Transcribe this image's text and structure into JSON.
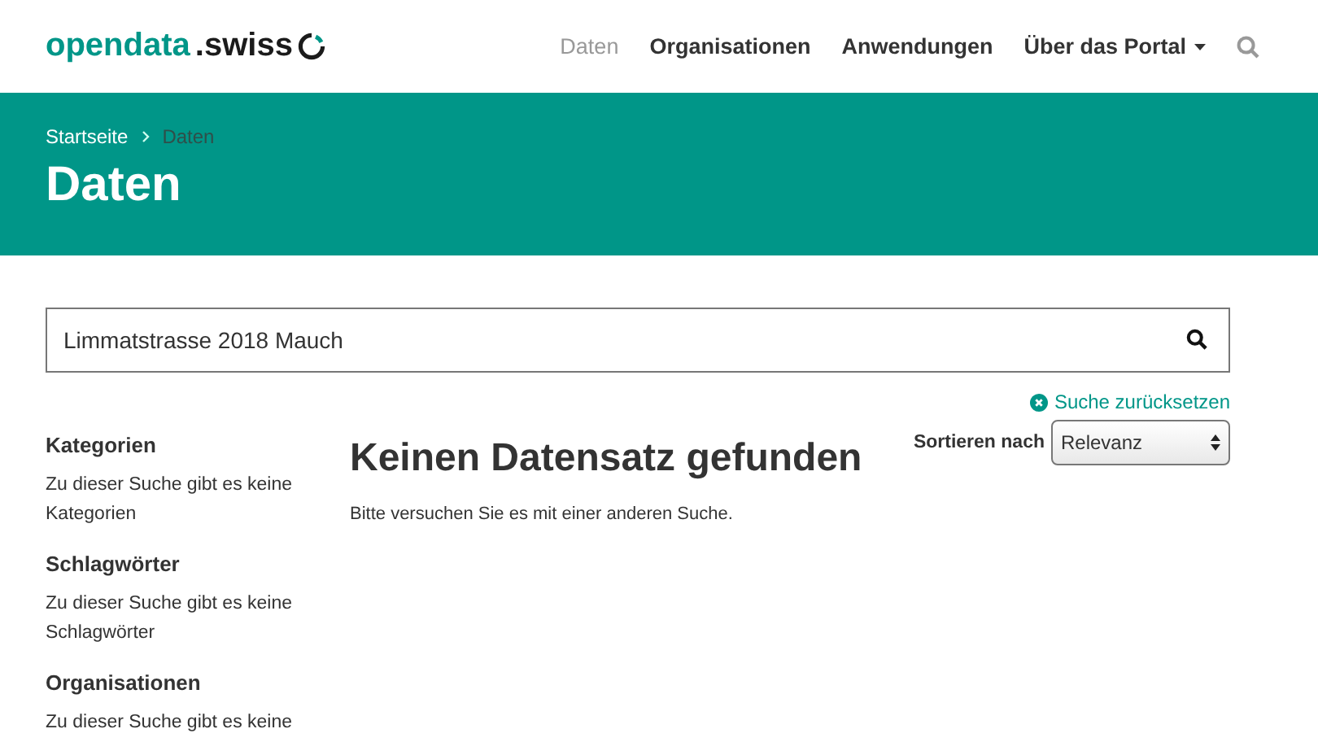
{
  "header": {
    "logo": {
      "primary": "opendata",
      "secondary": ".swiss"
    },
    "nav": [
      {
        "label": "Daten",
        "selected": true,
        "dropdown": false
      },
      {
        "label": "Organisationen",
        "selected": false,
        "dropdown": false
      },
      {
        "label": "Anwendungen",
        "selected": false,
        "dropdown": false
      },
      {
        "label": "Über das Portal",
        "selected": false,
        "dropdown": true
      }
    ]
  },
  "banner": {
    "breadcrumb": [
      {
        "label": "Startseite",
        "current": false
      },
      {
        "label": "Daten",
        "current": true
      }
    ],
    "title": "Daten"
  },
  "search": {
    "value": "Limmatstrasse 2018 Mauch",
    "reset_label": "Suche zurücksetzen"
  },
  "sidebar": [
    {
      "heading": "Kategorien",
      "text": "Zu dieser Suche gibt es keine Kategorien"
    },
    {
      "heading": "Schlagwörter",
      "text": "Zu dieser Suche gibt es keine Schlagwörter"
    },
    {
      "heading": "Organisationen",
      "text": "Zu dieser Suche gibt es keine"
    }
  ],
  "results": {
    "title": "Keinen Datensatz gefunden",
    "message": "Bitte versuchen Sie es mit einer anderen Suche.",
    "sort_label": "Sortieren nach",
    "sort_value": "Relevanz"
  }
}
